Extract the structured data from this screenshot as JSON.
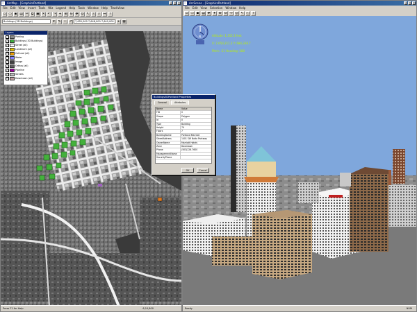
{
  "left_window": {
    "title": "ArcMap - [GraphicsPortland]",
    "menu": [
      "File",
      "Edit",
      "View",
      "Insert",
      "Tools",
      "Wiz",
      "Legend",
      "Help",
      "Tools",
      "Window",
      "Help",
      "TrackView"
    ],
    "layer_dropdown": "Buildings (3D Buildings)",
    "coord_box": "7,655,000   7,648,000   7,640,000",
    "toc": {
      "title": "Layers",
      "layers": [
        {
          "label": "Parking",
          "color": "#8a8a8a"
        },
        {
          "label": "Buildings (3D Buildings)",
          "color": "#40b040"
        },
        {
          "label": "Street (all)",
          "color": "#ffffff"
        },
        {
          "label": "Landmark (all)",
          "color": "#e0c000"
        },
        {
          "label": "Cultural (all)",
          "color": "#f0a000"
        },
        {
          "label": "Water",
          "color": "#8080ff"
        },
        {
          "label": "Image",
          "color": "#404040"
        },
        {
          "label": "Orthos (all)",
          "color": "#606060"
        },
        {
          "label": "Pipeline",
          "color": "#a000a0"
        },
        {
          "label": "Streets",
          "color": "#c0c0c0"
        },
        {
          "label": "Downtown (all)",
          "color": "#c0a0a0"
        }
      ]
    },
    "status": "Press F1 for Help",
    "status_coords": "6,10,800"
  },
  "dialog": {
    "title": "Buildings3DPortland Properties",
    "tabs": [
      "General",
      "Attributes"
    ],
    "col_headers": [
      "Name",
      "Value"
    ],
    "rows": [
      [
        "FID",
        "0"
      ],
      [
        "Shape",
        "Polygon"
      ],
      [
        "Id",
        "0"
      ],
      [
        "Type",
        "Building"
      ],
      [
        "Height",
        "79"
      ],
      [
        "Floors",
        "7"
      ],
      [
        "BuildingName",
        "Portland Marriott"
      ],
      [
        "StreetAddress",
        "1401 SW Naito Parkway"
      ],
      [
        "OwnerName",
        "Marriott Hotels"
      ],
      [
        "Zone",
        "Downtown"
      ],
      [
        "Phone",
        "(503)226-7600"
      ],
      [
        "ManagementName",
        ""
      ],
      [
        "SecurityPhone",
        ""
      ]
    ],
    "ok": "OK",
    "cancel": "Cancel"
  },
  "right_window": {
    "title": "ArcScene - [GraphicsPortland]",
    "menu": [
      "File",
      "Edit",
      "View",
      "Selection",
      "Window",
      "Help"
    ],
    "hud_lines": [
      "Altitude:  1,355.3 feet",
      "X: 7,650,211.2  Y: 684,338.7",
      "Pitch: -21  Heading: 280"
    ],
    "compass_label": "N",
    "status": "Ready",
    "status_right": "NUM"
  },
  "colors": {
    "sky": "#7fa7dc",
    "building_green": "#44b13c",
    "hud_text": "#b8f000",
    "title_blue": "#0a246a"
  }
}
